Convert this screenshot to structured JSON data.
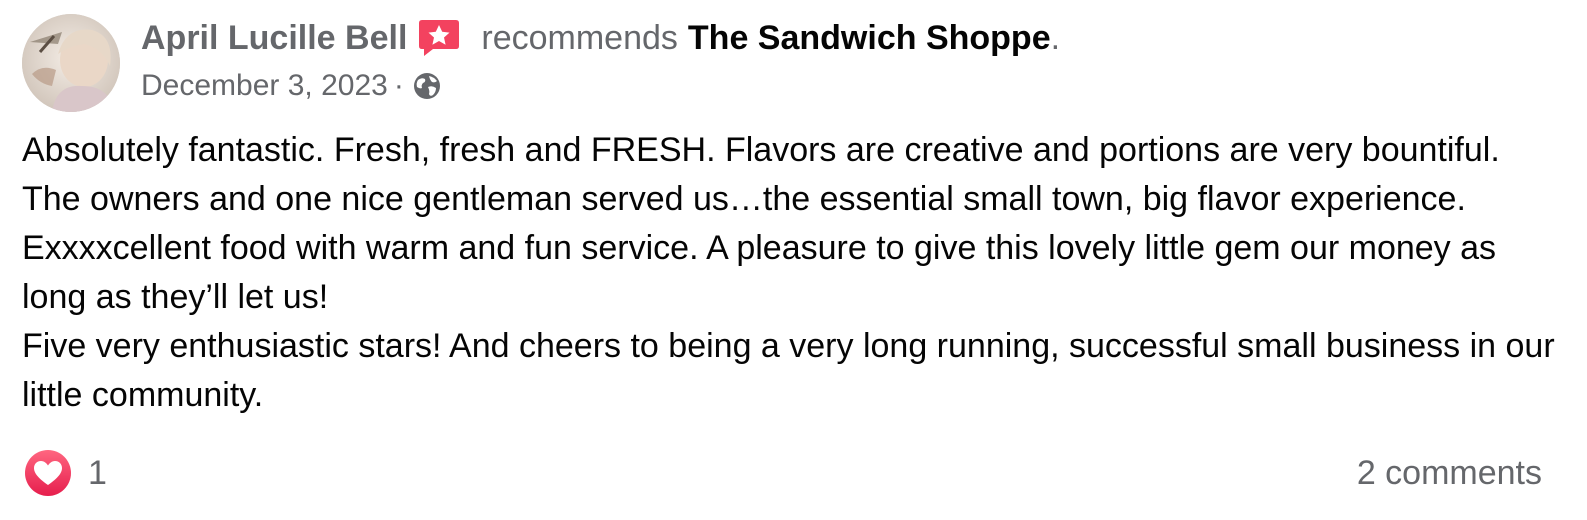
{
  "post": {
    "author": "April Lucille Bell",
    "recommend_verb": "recommends",
    "page_name": "The Sandwich Shoppe",
    "punctuation": ".",
    "date": "December 3, 2023",
    "separator": "·",
    "privacy_icon": "globe-icon",
    "badge_icon": "recommendation-badge-icon",
    "body_paragraphs": [
      "Absolutely fantastic. Fresh, fresh and FRESH. Flavors are creative and portions are very bountiful. The owners and one nice gentleman served us…the essential small town, big flavor experience. Exxxxcellent food with warm and fun service. A pleasure to give this lovely little gem our money as long as they’ll let us!",
      "Five very enthusiastic stars! And cheers to being a very long running, successful small business in our little community."
    ]
  },
  "footer": {
    "reaction_icon": "heart-icon",
    "reaction_count": "1",
    "comments_label": "2 comments"
  },
  "colors": {
    "secondary_text": "#65676b",
    "primary_text": "#050505",
    "badge": "#f3425f",
    "heart": "#f02849"
  }
}
